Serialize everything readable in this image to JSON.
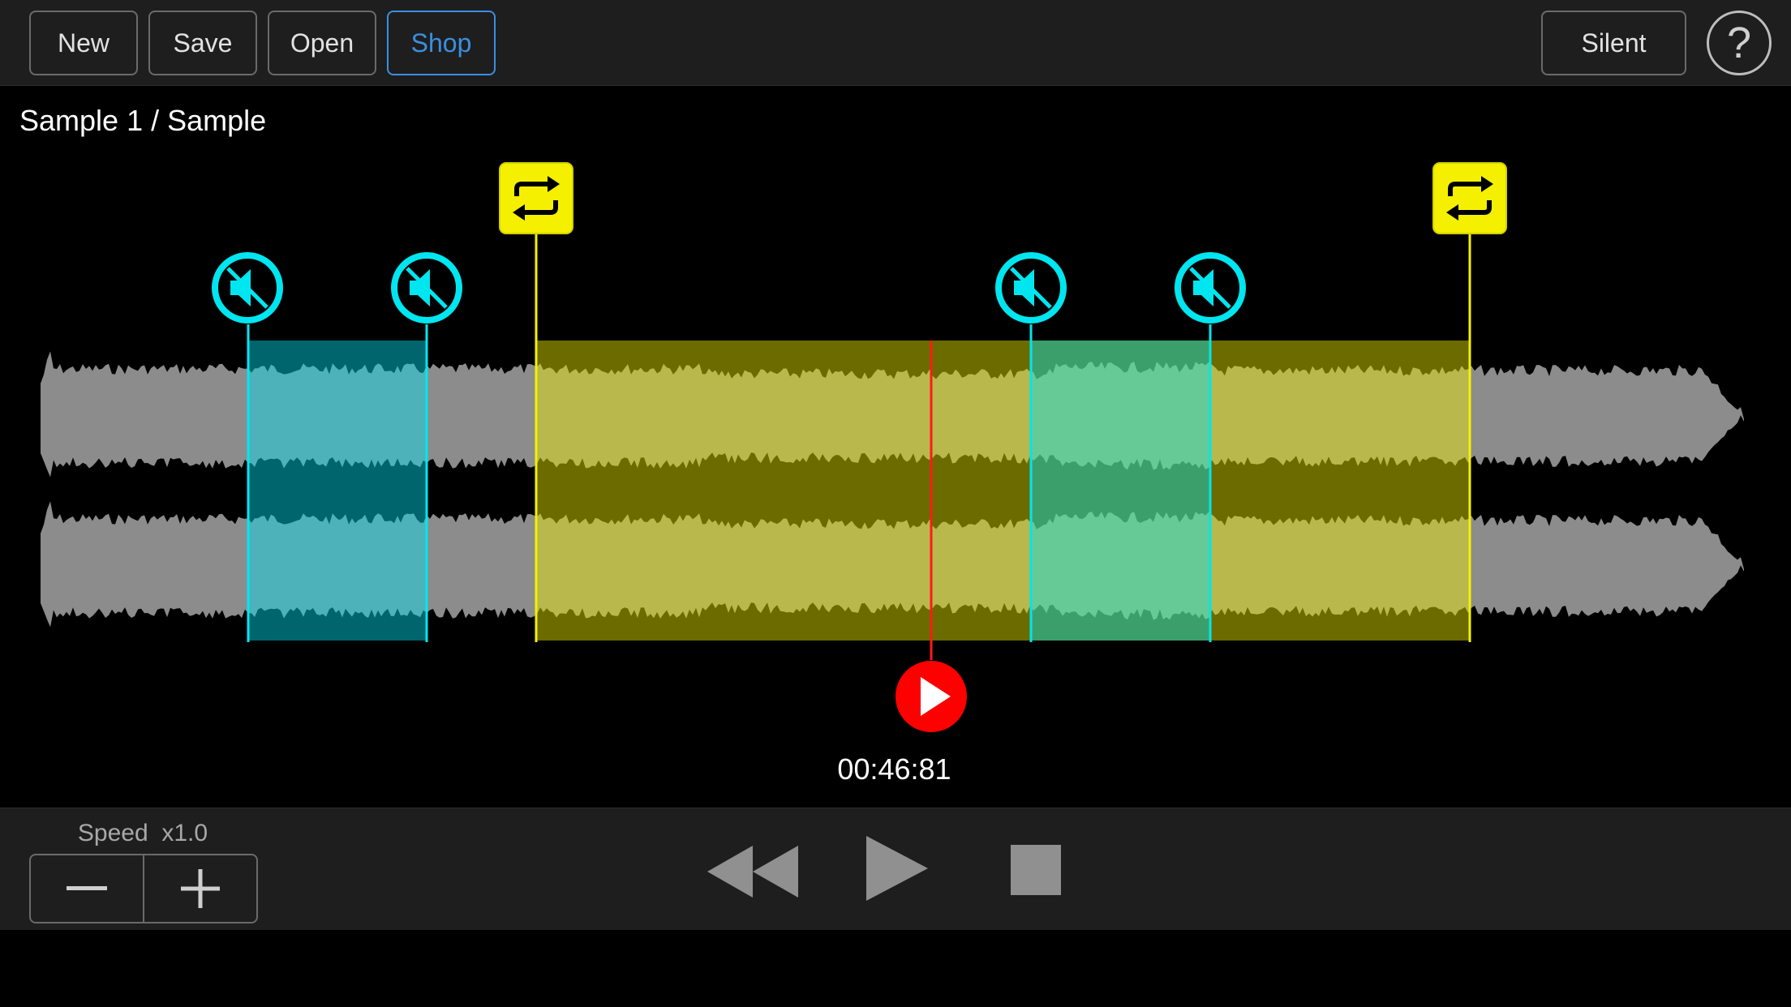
{
  "toolbar": {
    "new_label": "New",
    "save_label": "Save",
    "open_label": "Open",
    "shop_label": "Shop",
    "silent_label": "Silent",
    "help_label": "?"
  },
  "track": {
    "title": "Sample 1 / Sample"
  },
  "playback": {
    "time": "00:46:81"
  },
  "controls": {
    "speed_label": "Speed",
    "speed_value": "x1.0",
    "speed_down_icon": "minus-icon",
    "speed_up_icon": "plus-icon",
    "rewind_icon": "rewind-icon",
    "play_icon": "play-icon",
    "stop_icon": "stop-icon"
  },
  "markers": {
    "loop_icon": "loop-icon",
    "mute_icon": "mute-icon",
    "playhead_icon": "play-icon"
  },
  "colors": {
    "accent": "#3b8fe0",
    "loop": "#f5f000",
    "mute": "#00e6f0",
    "playhead": "#ff0000",
    "waveform": "#8c8c8c"
  }
}
